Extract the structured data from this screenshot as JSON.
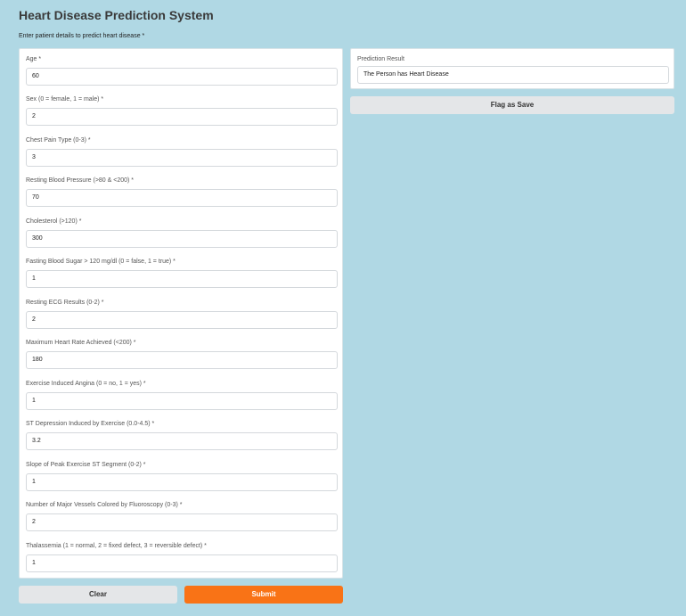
{
  "header": {
    "title": "Heart Disease Prediction System",
    "subtitle": "Enter patient details to predict heart disease *"
  },
  "form": {
    "fields": [
      {
        "label": "Age *",
        "value": "60"
      },
      {
        "label": "Sex (0 = female, 1 = male) *",
        "value": "2"
      },
      {
        "label": "Chest Pain Type (0-3) *",
        "value": "3"
      },
      {
        "label": "Resting Blood Pressure (>80 & <200) *",
        "value": "70"
      },
      {
        "label": "Cholesterol (>120) *",
        "value": "300"
      },
      {
        "label": "Fasting Blood Sugar > 120 mg/dl (0 = false, 1 = true) *",
        "value": "1"
      },
      {
        "label": "Resting ECG Results (0-2) *",
        "value": "2"
      },
      {
        "label": "Maximum Heart Rate Achieved (<200) *",
        "value": "180"
      },
      {
        "label": "Exercise Induced Angina (0 = no, 1 = yes) *",
        "value": "1"
      },
      {
        "label": "ST Depression Induced by Exercise (0.0-4.5) *",
        "value": "3.2"
      },
      {
        "label": "Slope of Peak Exercise ST Segment (0-2) *",
        "value": "1"
      },
      {
        "label": "Number of Major Vessels Colored by Fluoroscopy (0-3) *",
        "value": "2"
      },
      {
        "label": "Thalassemia (1 = normal, 2 = fixed defect, 3 = reversible defect) *",
        "value": "1"
      }
    ]
  },
  "result": {
    "label": "Prediction Result",
    "value": "The Person has Heart Disease"
  },
  "buttons": {
    "flag": "Flag as Save",
    "clear": "Clear",
    "submit": "Submit"
  },
  "colors": {
    "background": "#b0d8e4",
    "submit": "#f97316",
    "secondary_button": "#e4e6e8"
  }
}
